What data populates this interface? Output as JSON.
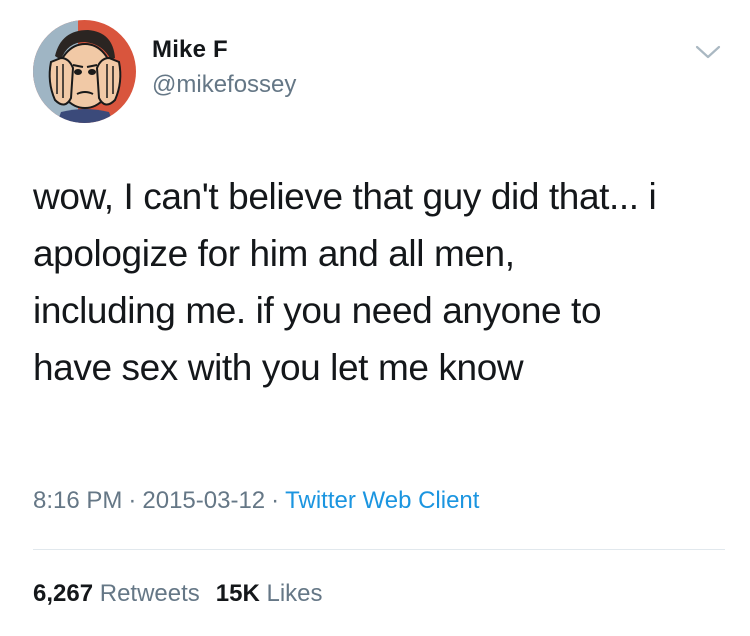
{
  "author": {
    "display_name": "Mike F",
    "handle": "@mikefossey"
  },
  "tweet": {
    "lines": [
      "wow, I can't believe that guy did that... i",
      "apologize for him and all men,",
      "including me. if you need anyone to",
      "have sex with you let me know"
    ]
  },
  "meta": {
    "time": "8:16 PM",
    "date": "2015-03-12",
    "separator": "·",
    "source": "Twitter Web Client"
  },
  "stats": {
    "retweets_count": "6,267",
    "retweets_label": "Retweets",
    "likes_count": "15K",
    "likes_label": "Likes"
  },
  "colors": {
    "text": "#14171a",
    "secondary": "#657786",
    "link": "#1b95e0",
    "divider": "#e1e8ed"
  },
  "icons": {
    "caret": "chevron-down-icon",
    "avatar": "comic-facepalm-avatar"
  }
}
